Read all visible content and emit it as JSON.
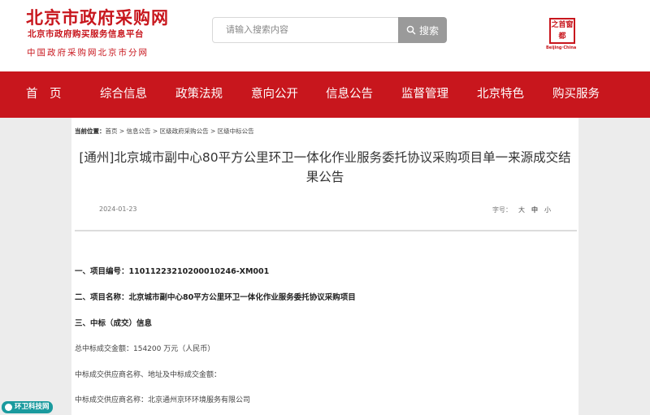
{
  "header": {
    "logo_title": "北京市政府采购网",
    "logo_subtitle": "北京市政府购买服务信息平台",
    "logo_subtitle2": "中国政府采购网北京市分网",
    "search_placeholder": "请输入搜索内容",
    "search_button": "搜索",
    "seal_chars": [
      "之",
      "首",
      "窗",
      "都"
    ],
    "seal_en": "Beijing·China"
  },
  "nav": {
    "items": [
      "首　页",
      "综合信息",
      "政策法规",
      "意向公开",
      "信息公告",
      "监督管理",
      "北京特色",
      "购买服务"
    ]
  },
  "breadcrumb": {
    "label": "当前位置：",
    "path": "首页 > 信息公告 > 区级政府采购公告 > 区级中标公告"
  },
  "article": {
    "title": "[通州]北京城市副中心80平方公里环卫一体化作业服务委托协议采购项目单一来源成交结果公告",
    "date": "2024-01-23",
    "font_size_label": "字号：",
    "font_sizes": [
      "大",
      "中",
      "小"
    ],
    "lines": [
      "一、项目编号：11011223210200010246-XM001",
      "二、项目名称：北京城市副中心80平方公里环卫一体化作业服务委托协议采购项目",
      "三、中标（成交）信息",
      "总中标成交金额：154200 万元（人民币）",
      "中标成交供应商名称、地址及中标成交金额：",
      "中标成交供应商名称：北京通州京环环境服务有限公司"
    ]
  },
  "watermark": "环卫科技网",
  "colors": {
    "brand_red": "#c8161d",
    "watermark_teal": "#1a9a9e"
  }
}
